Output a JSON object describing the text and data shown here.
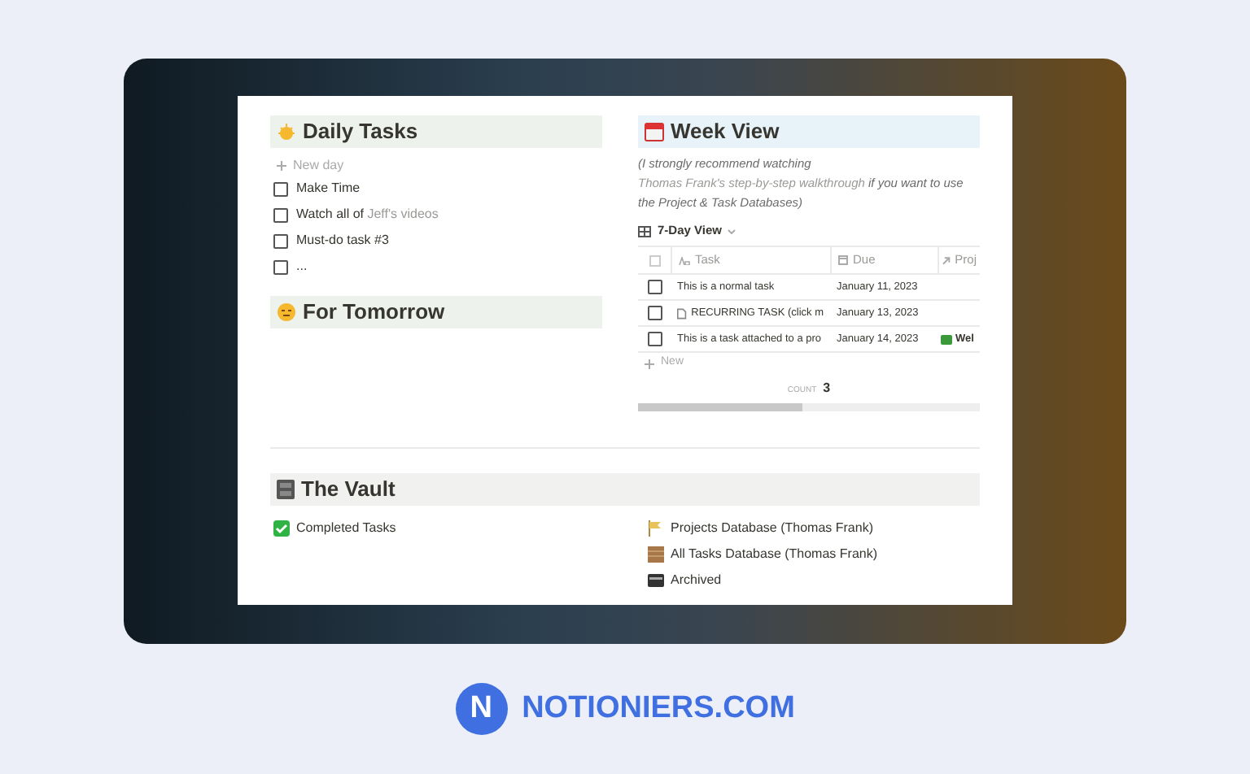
{
  "daily": {
    "title": "Daily Tasks",
    "new_label": "New day",
    "tasks": [
      {
        "parts": [
          {
            "text": "Make Time",
            "link": false
          }
        ],
        "checked": false
      },
      {
        "parts": [
          {
            "text": "Watch all of ",
            "link": false
          },
          {
            "text": "Jeff's videos",
            "link": true
          }
        ],
        "checked": false
      },
      {
        "parts": [
          {
            "text": "Must-do task #3",
            "link": false
          }
        ],
        "checked": false
      },
      {
        "parts": [
          {
            "text": "...",
            "link": false
          }
        ],
        "checked": false
      }
    ]
  },
  "tomorrow": {
    "title": "For Tomorrow"
  },
  "week": {
    "title": "Week View",
    "note": [
      {
        "text": "(I strongly recommend watching ",
        "link": false
      },
      {
        "text": "Thomas Frank's step-by-step walkthrough",
        "link": true
      },
      {
        "text": " if you want to use the Project & Task Databases)",
        "link": false
      }
    ],
    "view": "7-Day View",
    "columns": [
      "Task",
      "Due",
      "Proj"
    ],
    "rows": [
      {
        "task": "This is a normal task",
        "due": "January 11, 2023",
        "project": "",
        "page": false,
        "checked": false
      },
      {
        "task": "RECURRING TASK (click m",
        "due": "January 13, 2023",
        "project": "",
        "page": true,
        "checked": false
      },
      {
        "task": "This is a task attached to a pro",
        "due": "January 14, 2023",
        "project": "Wel",
        "page": false,
        "checked": false
      }
    ],
    "new_label": "New",
    "count_label": "COUNT",
    "count": "3"
  },
  "vault": {
    "title": "The Vault",
    "left": [
      {
        "label": "Completed Tasks",
        "kind": "check"
      }
    ],
    "right": [
      {
        "label": "Projects Database (Thomas Frank)",
        "kind": "flag"
      },
      {
        "label": "All Tasks Database (Thomas Frank)",
        "kind": "book"
      },
      {
        "label": "Archived",
        "kind": "box"
      }
    ]
  },
  "brand": {
    "letter": "N",
    "name": "NOTIONIERS.COM"
  }
}
